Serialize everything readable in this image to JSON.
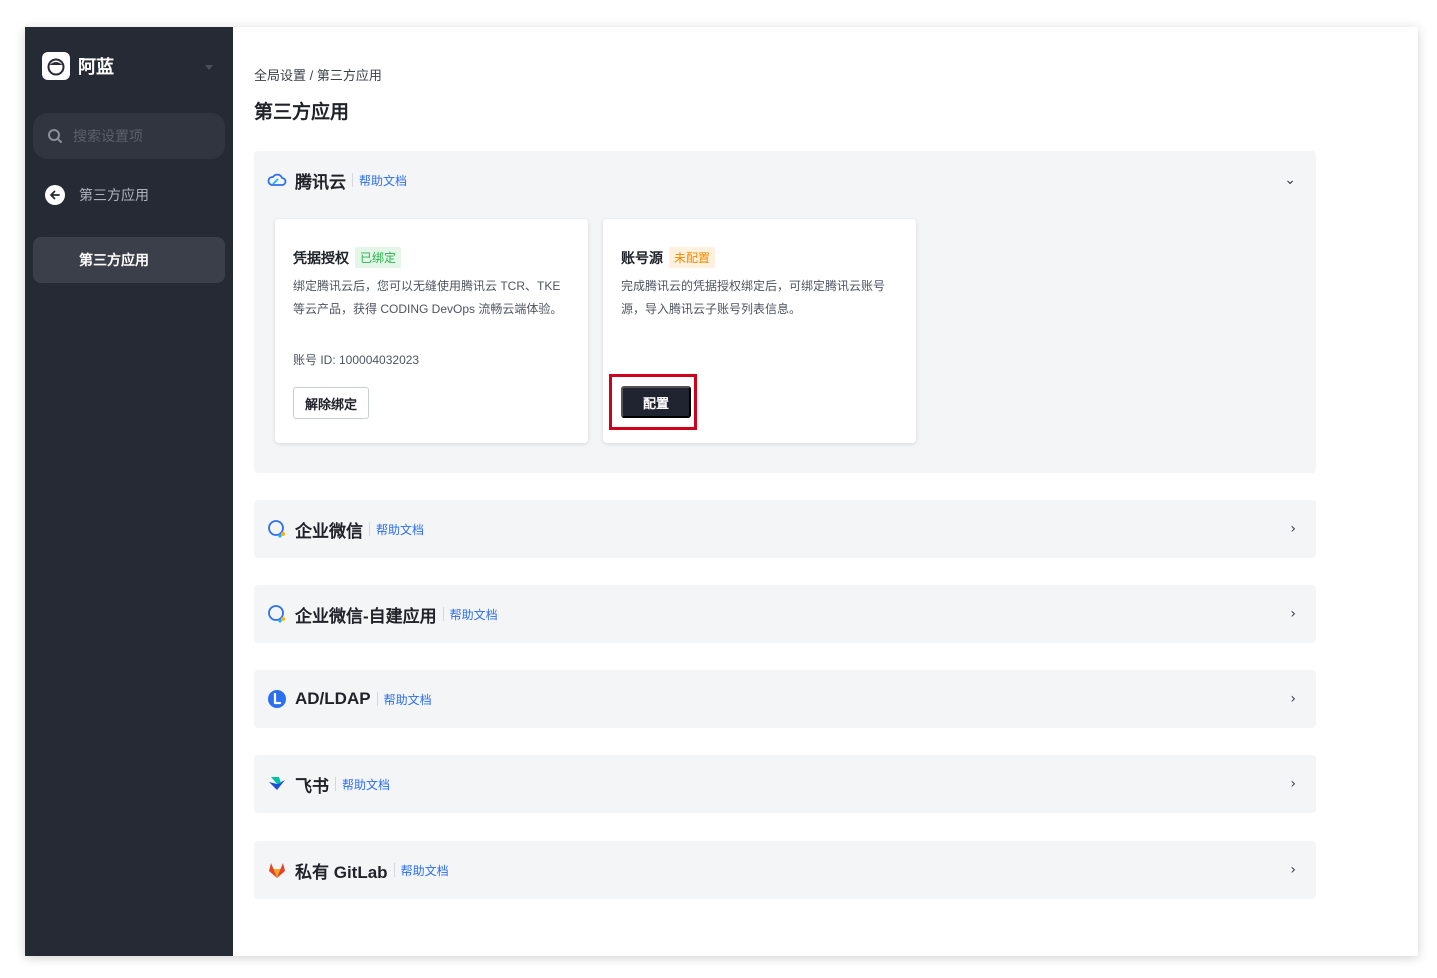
{
  "sidebar": {
    "brand": "阿蓝",
    "search_placeholder": "搜索设置项",
    "back_label": "第三方应用",
    "active_item": "第三方应用"
  },
  "header": {
    "breadcrumb": "全局设置 / 第三方应用",
    "title": "第三方应用"
  },
  "panels": [
    {
      "name": "腾讯云",
      "help": "帮助文档",
      "icon": "tencent-cloud-icon",
      "expanded": true,
      "cards": [
        {
          "title": "凭据授权",
          "badge": "已绑定",
          "desc": "绑定腾讯云后，您可以无缝使用腾讯云 TCR、TKE 等云产品，获得 CODING DevOps 流畅云端体验。",
          "account": "账号 ID: 100004032023",
          "button": "解除绑定"
        },
        {
          "title": "账号源",
          "badge": "未配置",
          "desc": "完成腾讯云的凭据授权绑定后，可绑定腾讯云账号源，导入腾讯云子账号列表信息。",
          "button": "配置"
        }
      ]
    },
    {
      "name": "企业微信",
      "help": "帮助文档",
      "icon": "wecom-icon"
    },
    {
      "name": "企业微信-自建应用",
      "help": "帮助文档",
      "icon": "wecom-icon"
    },
    {
      "name": "AD/LDAP",
      "help": "帮助文档",
      "icon": "ldap-icon"
    },
    {
      "name": "飞书",
      "help": "帮助文档",
      "icon": "feishu-icon"
    },
    {
      "name": "私有 GitLab",
      "help": "帮助文档",
      "icon": "gitlab-icon"
    }
  ],
  "colors": {
    "sidebar_bg": "#262a34",
    "link": "#2c6ff0",
    "highlight": "#d0021b"
  }
}
